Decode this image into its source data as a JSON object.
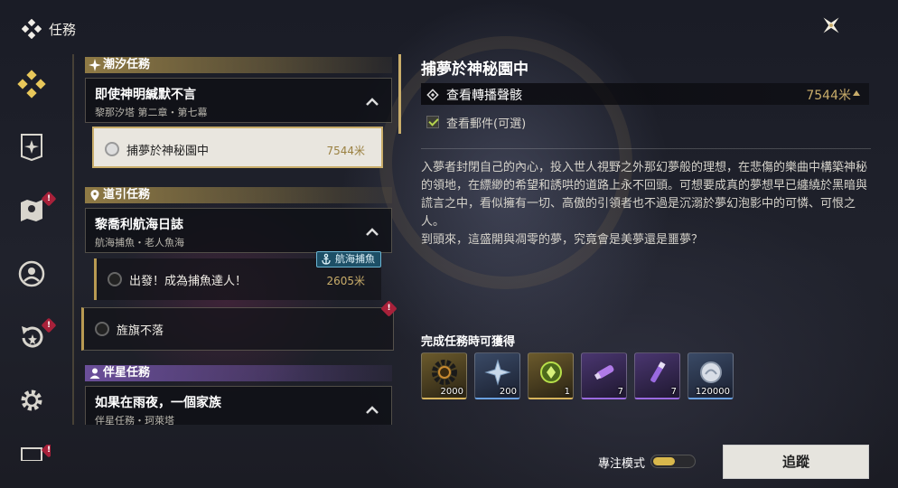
{
  "header": {
    "title": "任務"
  },
  "sidebar": {
    "items": [
      {
        "icon": "diamond-grid-icon",
        "active": true,
        "alert": false
      },
      {
        "icon": "banner-star-icon",
        "active": false,
        "alert": false
      },
      {
        "icon": "map-icon",
        "active": false,
        "alert": true
      },
      {
        "icon": "user-circle-icon",
        "active": false,
        "alert": false
      },
      {
        "icon": "return-star-icon",
        "active": false,
        "alert": true
      },
      {
        "icon": "gear-icon",
        "active": false,
        "alert": false
      },
      {
        "icon": "screen-icon",
        "active": false,
        "alert": true
      }
    ]
  },
  "quest_list": {
    "categories": {
      "tide": "潮汐任務",
      "guide": "道引任務",
      "star": "伴星任務"
    },
    "groups": [
      {
        "title": "即使神明緘默不言",
        "subtitle": "黎那汐塔 第二章・第七幕"
      },
      {
        "title": "黎喬利航海日誌",
        "subtitle": "航海捕魚・老人魚海"
      },
      {
        "title": "如果在雨夜，一個家族",
        "subtitle": "伴星任務・珂萊塔"
      }
    ],
    "quests": [
      {
        "label": "捕夢於神秘園中",
        "distance": "7544米"
      },
      {
        "label": "出發！成為捕魚達人！",
        "distance": "2605米",
        "badge": "航海捕魚"
      },
      {
        "label": "旌旗不落",
        "distance": ""
      }
    ]
  },
  "detail": {
    "title": "捕夢於神秘園中",
    "objective": {
      "label": "查看轉播聲骸",
      "distance": "7544米"
    },
    "sub_objective": "查看郵件(可選)",
    "description": [
      "入夢者封閉自己的內心，投入世人視野之外那幻夢般的理想，在悲傷的樂曲中構築神秘的領地，在縹緲的希望和誘哄的道路上永不回頭。可想要成真的夢想早已纏繞於黑暗與謊言之中，看似擁有一切、高傲的引領者也不過是沉溺於夢幻泡影中的可憐、可恨之人。",
      "到頭來，這盛開與凋零的夢，究竟會是美夢還是噩夢？"
    ],
    "reward_title": "完成任務時可獲得",
    "rewards": [
      {
        "icon": "gear-core-icon",
        "count": "2000",
        "rarity": "gold"
      },
      {
        "icon": "crystal-star-icon",
        "count": "200",
        "rarity": "blue"
      },
      {
        "icon": "green-orb-icon",
        "count": "1",
        "rarity": "gold"
      },
      {
        "icon": "purple-tube-icon",
        "count": "7",
        "rarity": "purple"
      },
      {
        "icon": "purple-tool-icon",
        "count": "7",
        "rarity": "purple"
      },
      {
        "icon": "shell-coin-icon",
        "count": "120000",
        "rarity": "blue"
      }
    ]
  },
  "footer": {
    "focus_mode_label": "專注模式",
    "track_button": "追蹤"
  },
  "colors": {
    "accent_gold": "#c9ad6a",
    "alert_red": "#a8213a",
    "companion_purple": "#6b4f9a"
  }
}
